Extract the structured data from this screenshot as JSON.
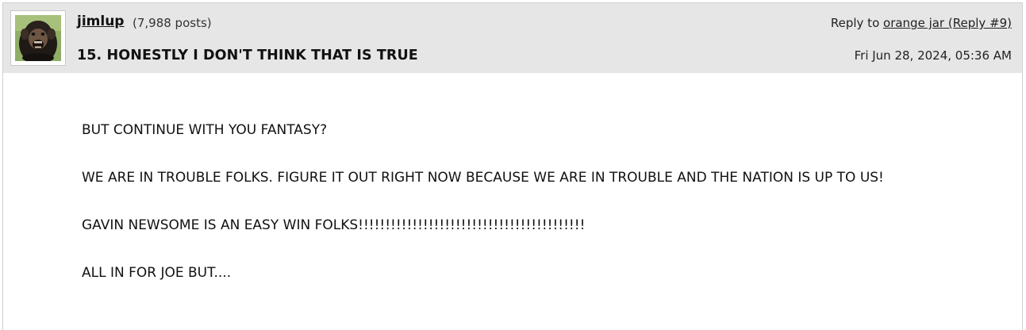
{
  "post": {
    "username": "jimlup",
    "post_count": "(7,988 posts)",
    "subject": "15. HONESTLY I DON'T THINK THAT IS TRUE",
    "reply_prefix": "Reply to ",
    "reply_target": "orange jar (Reply #9)",
    "timestamp": "Fri Jun 28, 2024, 05:36 AM",
    "avatar_icon": "chimpanzee-avatar",
    "body": [
      "BUT CONTINUE WITH YOU FANTASY?",
      "WE ARE IN TROUBLE FOLKS. FIGURE IT OUT RIGHT NOW BECAUSE WE ARE IN TROUBLE AND THE NATION IS UP TO US!",
      "GAVIN NEWSOME IS AN EASY WIN FOLKS!!!!!!!!!!!!!!!!!!!!!!!!!!!!!!!!!!!!!!!!!!",
      "ALL IN FOR JOE BUT...."
    ]
  },
  "colors": {
    "header_bg": "#e6e6e6",
    "body_bg": "#ffffff",
    "text": "#111111"
  }
}
